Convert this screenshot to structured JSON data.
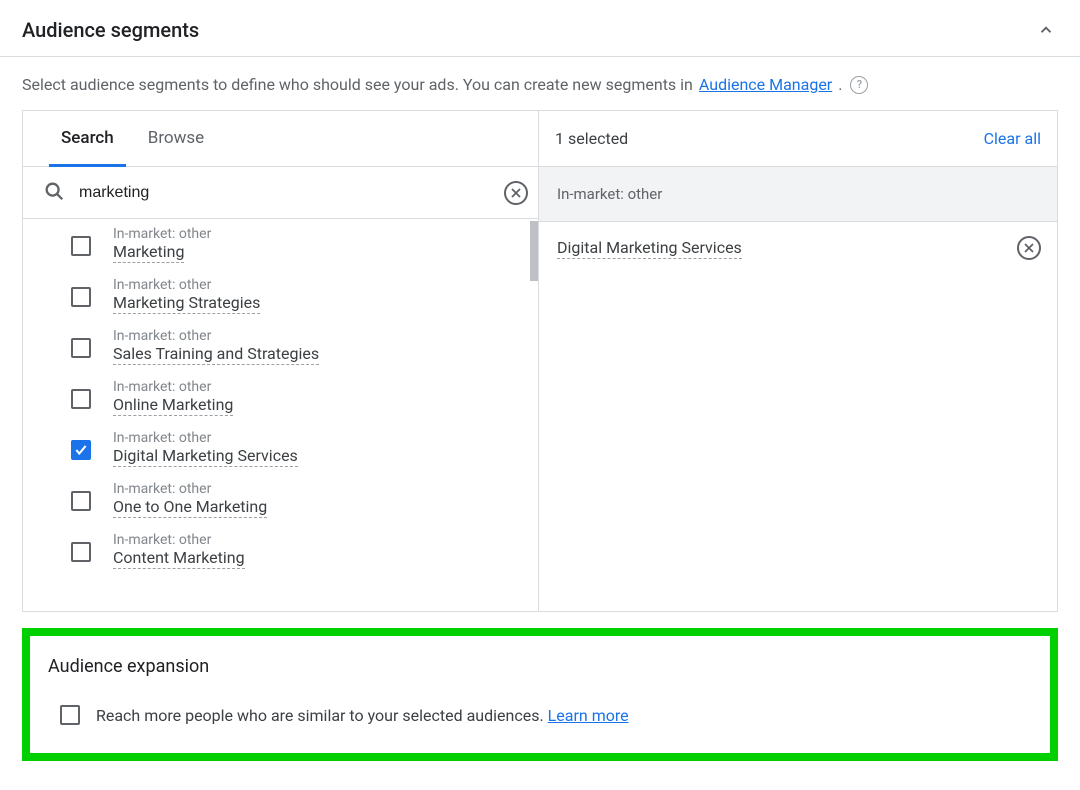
{
  "header": {
    "title": "Audience segments"
  },
  "intro": {
    "text_before": "Select audience segments to define who should see your ads. You can create new segments in ",
    "link_text": "Audience Manager",
    "text_after": "."
  },
  "tabs": {
    "search": "Search",
    "browse": "Browse",
    "active": "search"
  },
  "search": {
    "value": "marketing",
    "placeholder": "Search"
  },
  "results": [
    {
      "category": "In-market: other",
      "name": "Marketing",
      "checked": false
    },
    {
      "category": "In-market: other",
      "name": "Marketing Strategies",
      "checked": false
    },
    {
      "category": "In-market: other",
      "name": "Sales Training and Strategies",
      "checked": false
    },
    {
      "category": "In-market: other",
      "name": "Online Marketing",
      "checked": false
    },
    {
      "category": "In-market: other",
      "name": "Digital Marketing Services",
      "checked": true
    },
    {
      "category": "In-market: other",
      "name": "One to One Marketing",
      "checked": false
    },
    {
      "category": "In-market: other",
      "name": "Content Marketing",
      "checked": false
    }
  ],
  "selected": {
    "count_label": "1 selected",
    "clear_all": "Clear all",
    "group_header": "In-market: other",
    "items": [
      {
        "name": "Digital Marketing Services"
      }
    ]
  },
  "expansion": {
    "title": "Audience expansion",
    "checked": false,
    "text": "Reach more people who are similar to your selected audiences. ",
    "learn_more": "Learn more"
  }
}
